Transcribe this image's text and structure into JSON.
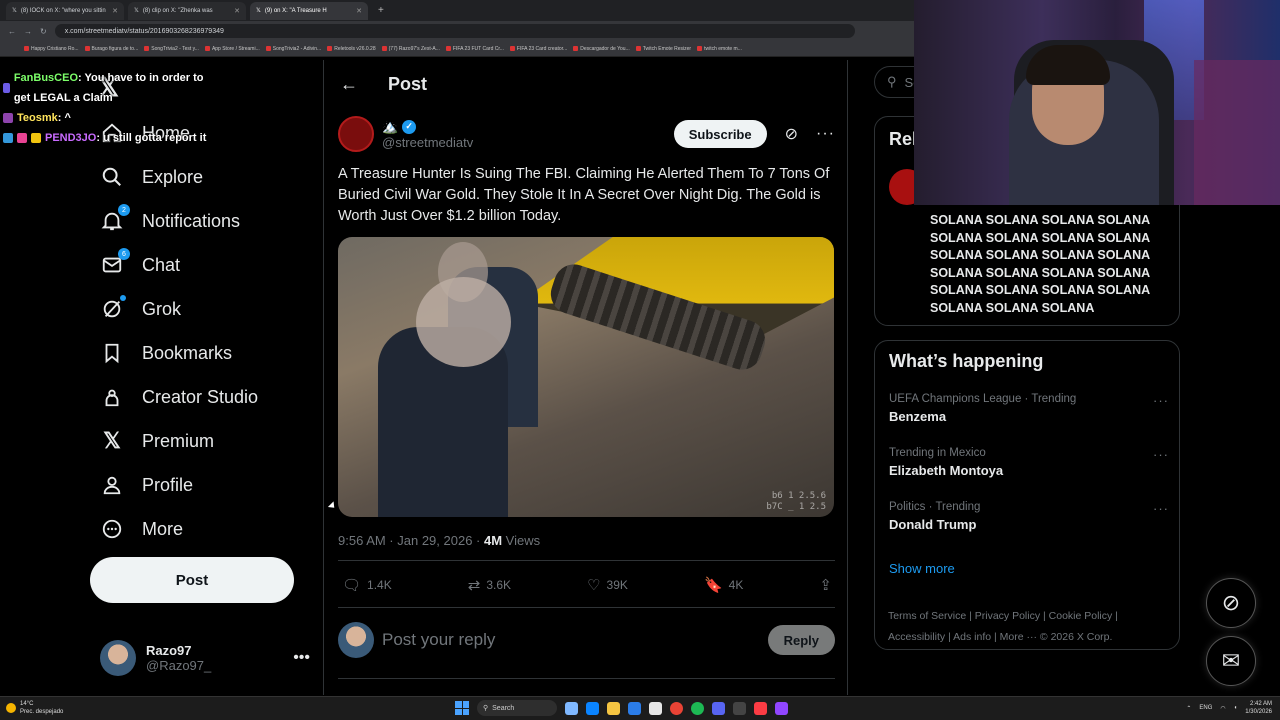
{
  "browser": {
    "tabs": [
      {
        "label": "(8) IOCK on X: \"where you sittin",
        "active": false
      },
      {
        "label": "(8) clip on X: \"Zhenka was",
        "active": false
      },
      {
        "label": "(9) on X: \"A Treasure H",
        "active": true
      }
    ],
    "url": "x.com/streetmediatv/status/2016903268236979349",
    "bookmarks": [
      "Happy Cristiano Ro...",
      "Burago figura de to...",
      "SongTrivia2 - Test y...",
      "App Store / Streami...",
      "SongTrivia2 - Adivin...",
      "Reletools v26.0.28",
      "(77) Razo97's Zest-A...",
      "FIFA 23 FUT Card Cr...",
      "FIFA 23 Card creator...",
      "Descargador de You...",
      "Twitch Emote Resizer",
      "twitch emote m..."
    ]
  },
  "chat": [
    {
      "user": "FanBusCEO",
      "message": ": You have to in order to get LEGAL a Claim",
      "color": "#7dff6a"
    },
    {
      "user": "Teosmk",
      "message": ": ^",
      "color": "#ffe45c"
    },
    {
      "user": "PEND3JO",
      "message": ": u still gotta report it",
      "color": "#c96bff"
    }
  ],
  "nav": {
    "items": [
      {
        "label": "Home",
        "icon": "home-icon"
      },
      {
        "label": "Explore",
        "icon": "search-icon"
      },
      {
        "label": "Notifications",
        "icon": "bell-icon",
        "badge": "2"
      },
      {
        "label": "Chat",
        "icon": "mail-icon",
        "badge": "6"
      },
      {
        "label": "Grok",
        "icon": "grok-icon"
      },
      {
        "label": "Bookmarks",
        "icon": "bookmark-icon"
      },
      {
        "label": "Creator Studio",
        "icon": "creator-studio-icon"
      },
      {
        "label": "Premium",
        "icon": "x-premium-icon"
      },
      {
        "label": "Profile",
        "icon": "person-icon"
      },
      {
        "label": "More",
        "icon": "more-circle-icon"
      }
    ],
    "post_label": "Post",
    "account": {
      "name": "Razo97",
      "handle": "@Razo97_"
    }
  },
  "post": {
    "header_title": "Post",
    "author_name": "🏔️",
    "author_handle": "@streetmediatv",
    "subscribe_label": "Subscribe",
    "text": "A Treasure Hunter Is Suing The FBI. Claiming He Alerted Them To 7 Tons Of Buried Civil War Gold. They Stole It In A Secret Over Night Dig. The Gold is Worth Just Over $1.2 billion Today.",
    "media_watermark_line1": "b6 1 2.5.6",
    "media_watermark_line2": "b7C _ 1 2.5",
    "timestamp": "9:56 AM · Jan 29, 2026 · ",
    "views_count": "4M",
    "views_label": " Views",
    "replies": "1.4K",
    "reposts": "3.6K",
    "likes": "39K",
    "bookmarks": "4K",
    "reply_placeholder": "Post your reply",
    "reply_button": "Reply"
  },
  "sidebar": {
    "search_placeholder": "Se",
    "relevant_title": "Rel",
    "solana_text": "SOLANA SOLANA SOLANA SOLANA SOLANA SOLANA SOLANA SOLANA SOLANA SOLANA SOLANA SOLANA SOLANA SOLANA SOLANA SOLANA SOLANA SOLANA SOLANA SOLANA SOLANA SOLANA SOLANA",
    "happening_title": "What’s happening",
    "trends": [
      {
        "context": "UEFA Champions League · Trending",
        "name": "Benzema"
      },
      {
        "context": "Trending in Mexico",
        "name": "Elizabeth Montoya"
      },
      {
        "context": "Politics · Trending",
        "name": "Donald Trump"
      }
    ],
    "show_more": "Show more",
    "footer": {
      "line1": "Terms of Service  |  Privacy Policy  |  Cookie Policy  |",
      "line2": "Accessibility  |  Ads info  |  More ···  © 2026 X Corp."
    }
  },
  "taskbar": {
    "temperature": "14°C",
    "weather": "Prec. despejado",
    "search_label": "Search",
    "language": "ENG",
    "time": "2:42 AM",
    "date": "1/30/2026"
  },
  "colors": {
    "accent": "#1d9bf0",
    "background": "#000000",
    "muted": "#71767b"
  }
}
